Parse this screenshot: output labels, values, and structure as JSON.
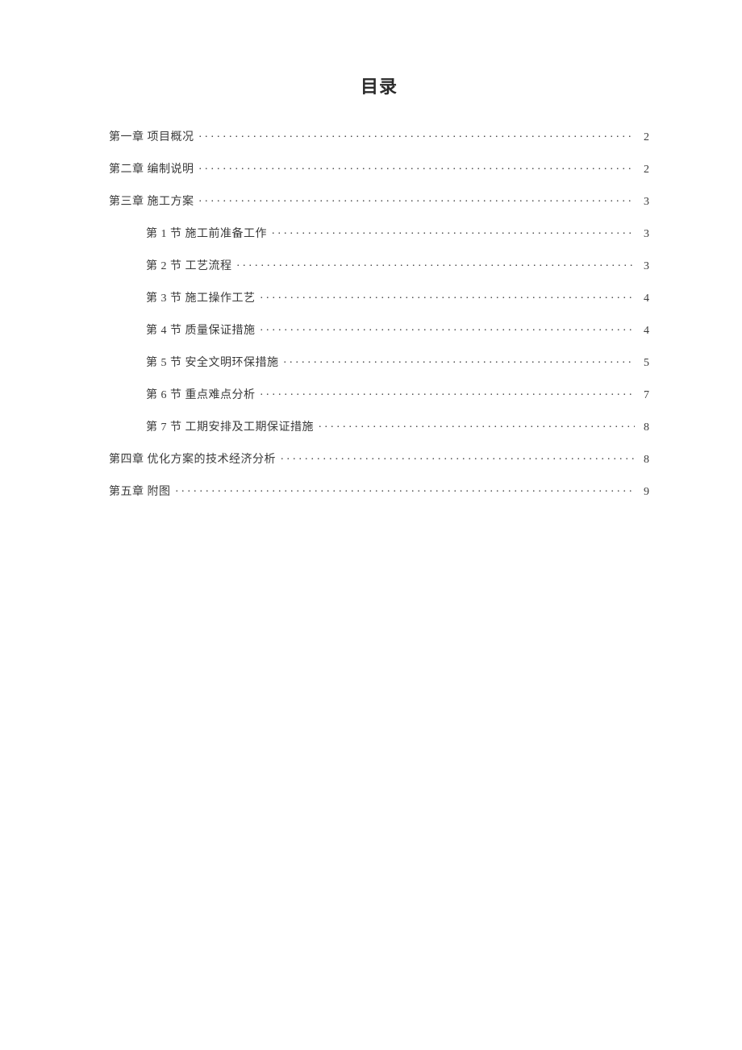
{
  "title": "目录",
  "entries": [
    {
      "level": 1,
      "label": "第一章  项目概况",
      "page": "2"
    },
    {
      "level": 1,
      "label": "第二章  编制说明",
      "page": "2"
    },
    {
      "level": 1,
      "label": "第三章  施工方案",
      "page": "3"
    },
    {
      "level": 2,
      "label": "第 1 节  施工前准备工作",
      "page": "3"
    },
    {
      "level": 2,
      "label": "第 2 节  工艺流程",
      "page": "3"
    },
    {
      "level": 2,
      "label": "第 3 节  施工操作工艺",
      "page": "4"
    },
    {
      "level": 2,
      "label": "第 4 节  质量保证措施",
      "page": "4"
    },
    {
      "level": 2,
      "label": "第 5 节  安全文明环保措施",
      "page": "5"
    },
    {
      "level": 2,
      "label": "第 6 节  重点难点分析",
      "page": "7"
    },
    {
      "level": 2,
      "label": "第 7 节  工期安排及工期保证措施",
      "page": "8"
    },
    {
      "level": 1,
      "label": "第四章  优化方案的技术经济分析",
      "page": "8"
    },
    {
      "level": 1,
      "label": "第五章  附图",
      "page": "9"
    }
  ]
}
